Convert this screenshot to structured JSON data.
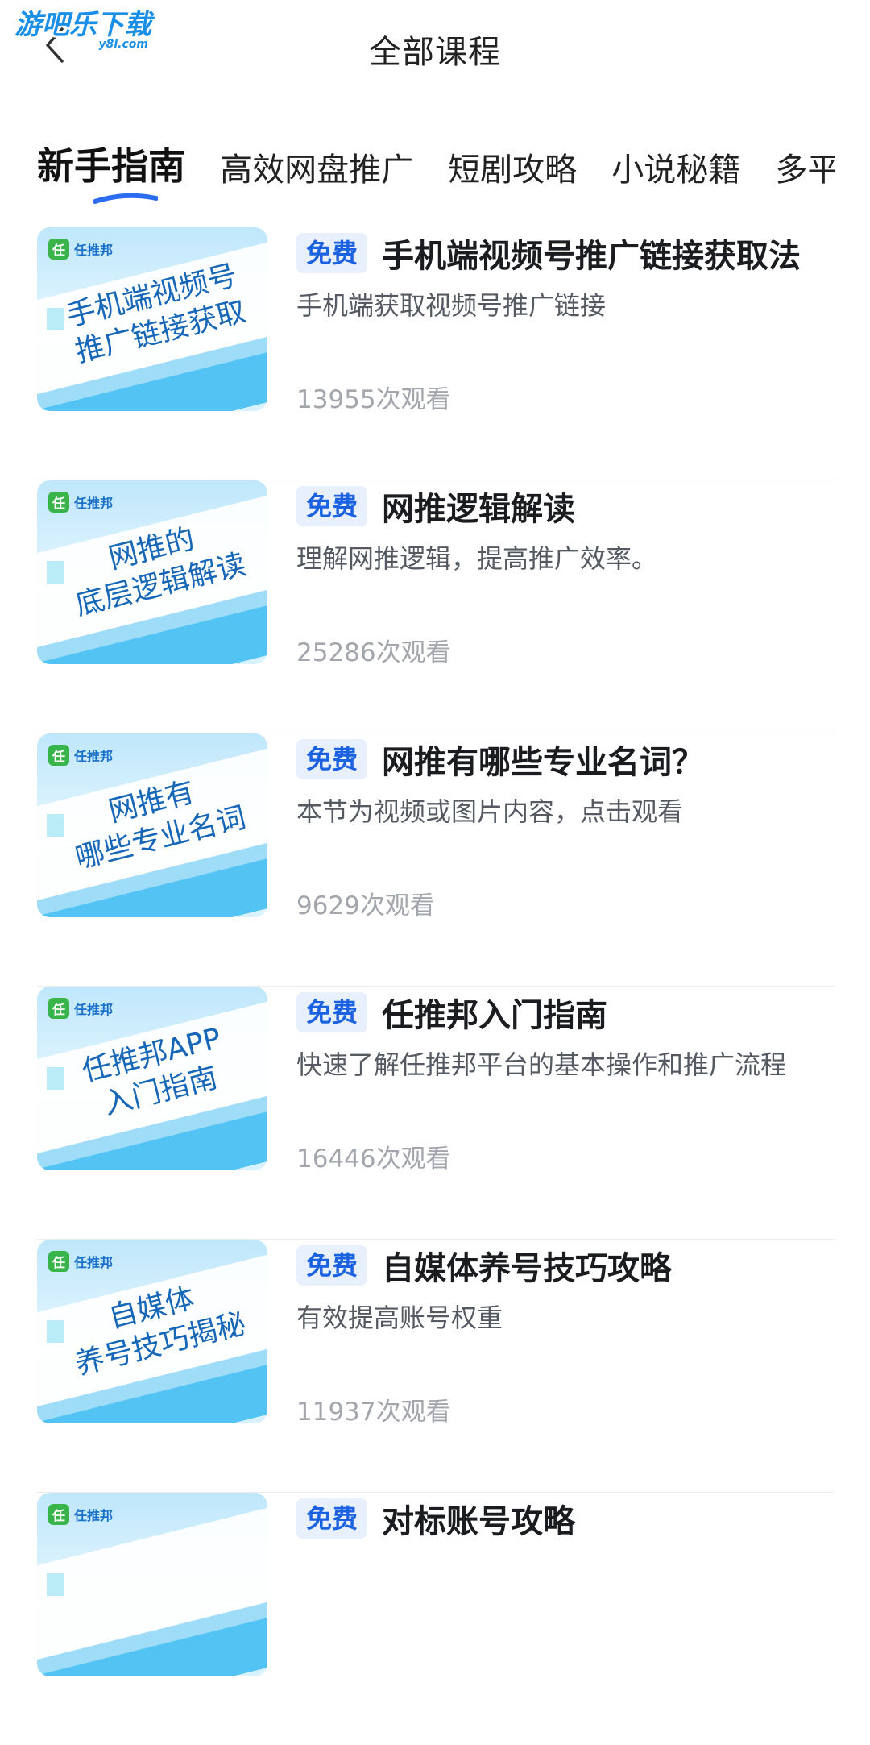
{
  "header": {
    "title": "全部课程",
    "back_icon": "back-arrow-icon",
    "watermark": "游吧乐下载",
    "watermark_sub": "y8l.com"
  },
  "tabs": [
    {
      "label": "新手指南",
      "active": true
    },
    {
      "label": "高效网盘推广",
      "active": false
    },
    {
      "label": "短剧攻略",
      "active": false
    },
    {
      "label": "小说秘籍",
      "active": false
    },
    {
      "label": "多平台",
      "active": false
    }
  ],
  "colors": {
    "accent": "#1b62e0",
    "badge_bg": "#e8f0fd",
    "thumb_text": "#1767b8",
    "thumb_stripe": "#52c3f3"
  },
  "thumb_brand": {
    "icon": "任",
    "name": "任推邦"
  },
  "courses": [
    {
      "badge": "免费",
      "title": "手机端视频号推广链接获取法",
      "desc": "手机端获取视频号推广链接",
      "views": "13955次观看",
      "thumb_text": "手机端视频号\n推广链接获取"
    },
    {
      "badge": "免费",
      "title": "网推逻辑解读",
      "desc": "理解网推逻辑，提高推广效率。",
      "views": "25286次观看",
      "thumb_text": "网推的\n底层逻辑解读"
    },
    {
      "badge": "免费",
      "title": "网推有哪些专业名词？",
      "desc": "本节为视频或图片内容，点击观看",
      "views": "9629次观看",
      "thumb_text": "网推有\n哪些专业名词"
    },
    {
      "badge": "免费",
      "title": "任推邦入门指南",
      "desc": "快速了解任推邦平台的基本操作和推广流程",
      "views": "16446次观看",
      "thumb_text": "任推邦APP\n入门指南"
    },
    {
      "badge": "免费",
      "title": "自媒体养号技巧攻略",
      "desc": "有效提高账号权重",
      "views": "11937次观看",
      "thumb_text": "自媒体\n养号技巧揭秘"
    },
    {
      "badge": "免费",
      "title": "对标账号攻略",
      "desc": "",
      "views": "",
      "thumb_text": ""
    }
  ]
}
